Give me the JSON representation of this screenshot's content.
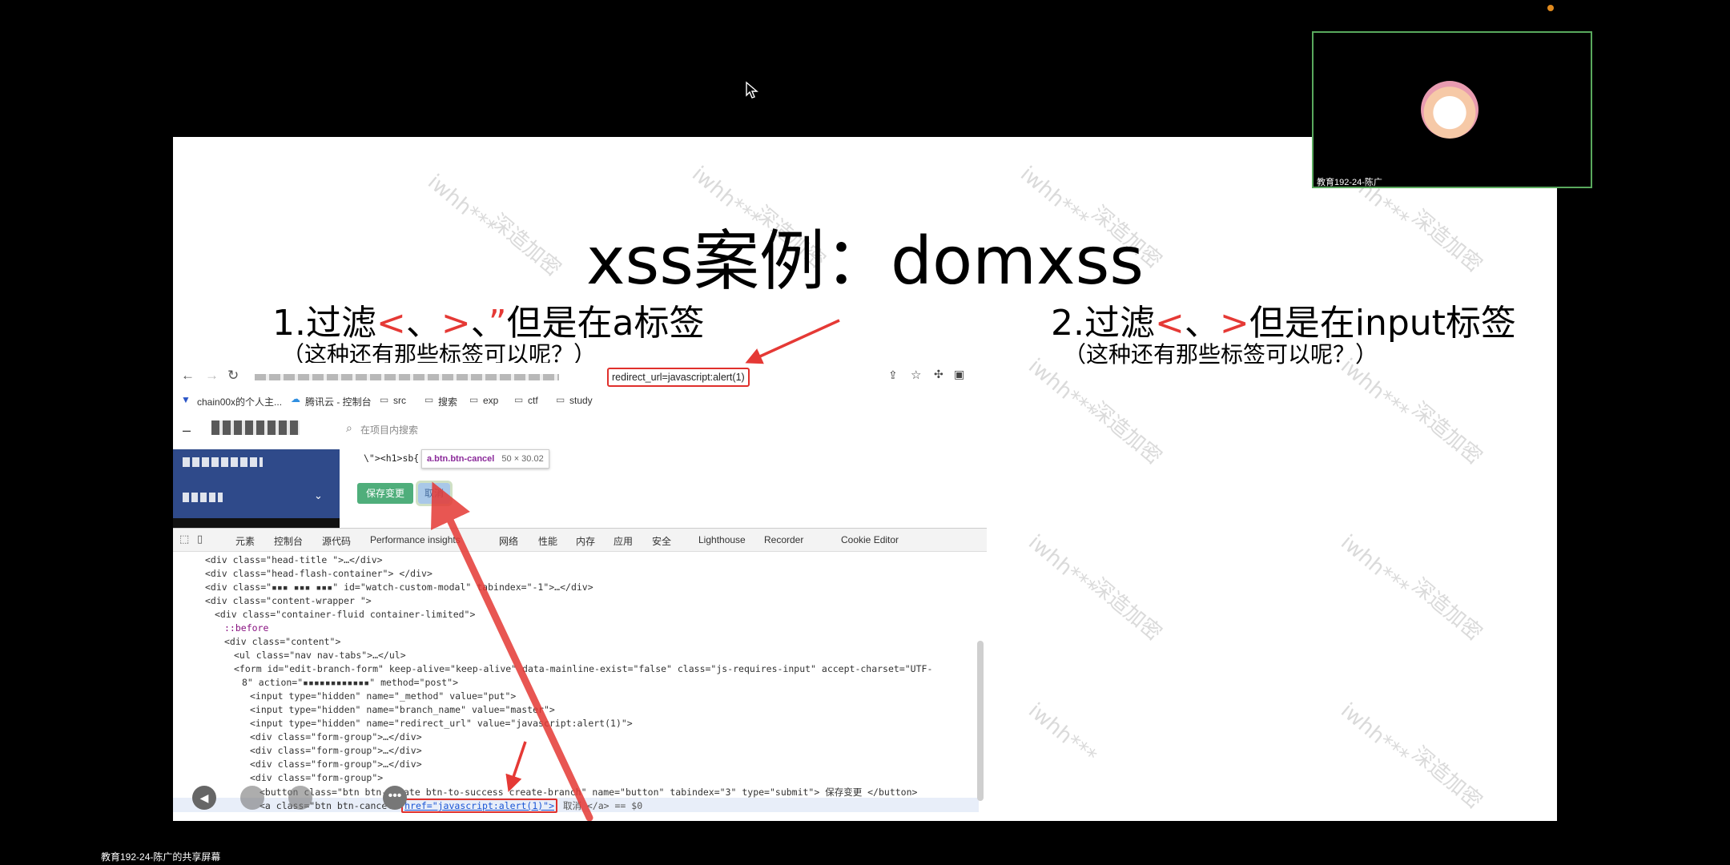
{
  "slide": {
    "title": "xss案例：domxss",
    "left_caption_parts": [
      "1.过滤",
      "<",
      "、",
      ">",
      "、",
      "”",
      "但是在a标签"
    ],
    "left_subcaption": "（这种还有那些标签可以呢？）",
    "right_caption_parts": [
      "2.过滤",
      "<",
      "、",
      ">",
      "但是在input标签"
    ],
    "right_subcaption": "（这种还有那些标签可以呢？）",
    "watermark_text_a": "iwhh***",
    "watermark_text_b": "深造加密"
  },
  "browser": {
    "url_highlight": "redirect_url=javascript:alert(1)",
    "bookmarks": [
      "chain00x的个人主...",
      "腾讯云 - 控制台",
      "src",
      "搜索",
      "exp",
      "ctf",
      "study"
    ],
    "search_placeholder": "在项目内搜索",
    "input_value": "\\\"><h1>sb{",
    "tooltip_selector": "a.btn.btn-cancel",
    "tooltip_size": "50 × 30.02",
    "save_button": "保存变更",
    "cancel_button": "取消"
  },
  "devtools": {
    "tabs": [
      "元素",
      "控制台",
      "源代码",
      "Performance insights",
      "网络",
      "性能",
      "内存",
      "应用",
      "安全",
      "Lighthouse",
      "Recorder",
      "Cookie Editor"
    ],
    "lines": [
      "<div class=\"head-title \">…</div>",
      "<div class=\"head-flash-container\"> </div>",
      "<div class=\"▪▪▪ ▪▪▪ ▪▪▪\" id=\"watch-custom-modal\" tabindex=\"-1\">…</div>",
      "<div class=\"content-wrapper \">",
      "<div class=\"container-fluid container-limited\">",
      "::before",
      "<div class=\"content\">",
      "<ul class=\"nav nav-tabs\">…</ul>",
      "<form id=\"edit-branch-form\" keep-alive=\"keep-alive\" data-mainline-exist=\"false\" class=\"js-requires-input\" accept-charset=\"UTF-",
      "8\" action=\"▪▪▪▪▪▪▪▪▪▪▪▪\" method=\"post\">",
      "<input type=\"hidden\" name=\"_method\" value=\"put\">",
      "<input type=\"hidden\" name=\"branch_name\" value=\"master\">",
      "<input type=\"hidden\" name=\"redirect_url\" value=\"javascript:alert(1)\">",
      "<div class=\"form-group\">…</div>",
      "<div class=\"form-group\">…</div>",
      "<div class=\"form-group\">…</div>",
      "<div class=\"form-group\">",
      "<button class=\"btn btn-create btn-to-success create-branch\" name=\"button\" tabindex=\"3\" type=\"submit\"> 保存变更 </button>"
    ],
    "last_line_prefix": "<a class=\"btn btn-cancel\"",
    "last_line_href": "href=\"javascript:alert(1)\">",
    "last_line_suffix": " 取消 </a> == $0"
  },
  "meeting": {
    "participant_name": "教育192-24-陈广",
    "share_label": "教育192-24-陈广的共享屏幕"
  },
  "colors": {
    "accent_red": "#e53935",
    "tile_border": "#59a95d",
    "save_green": "#4fae7b",
    "sidebar_blue": "#2f4a8a"
  }
}
